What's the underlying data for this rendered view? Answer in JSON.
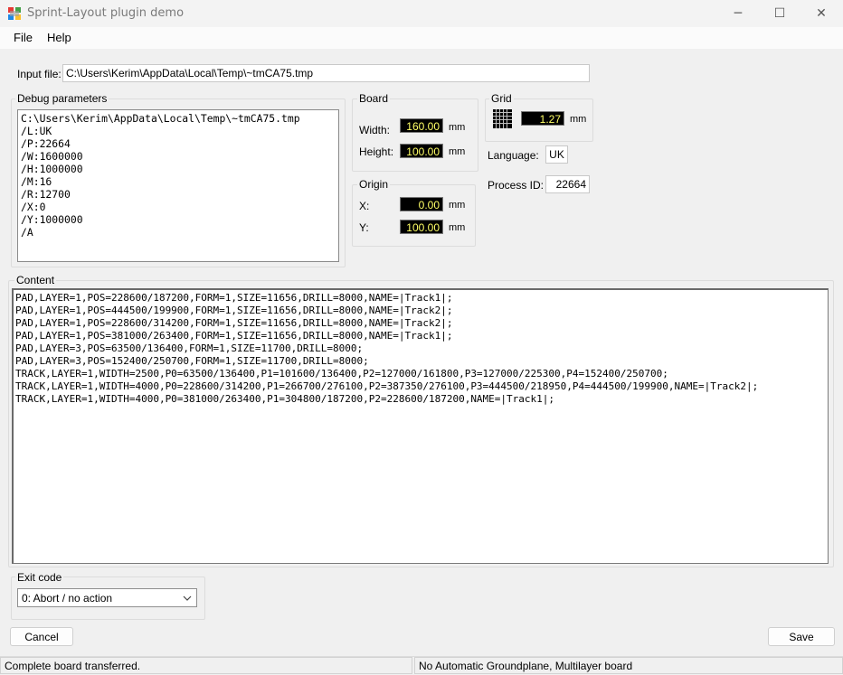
{
  "window": {
    "title": "Sprint-Layout plugin demo",
    "minimize_glyph": "─",
    "maximize_glyph": "☐",
    "close_glyph": "✕"
  },
  "menu": {
    "items": [
      "File",
      "Help"
    ]
  },
  "input_file": {
    "label": "Input file:",
    "value": "C:\\Users\\Kerim\\AppData\\Local\\Temp\\~tmCA75.tmp"
  },
  "debug": {
    "title": "Debug parameters",
    "text": "C:\\Users\\Kerim\\AppData\\Local\\Temp\\~tmCA75.tmp\n/L:UK\n/P:22664\n/W:1600000\n/H:1000000\n/M:16\n/R:12700\n/X:0\n/Y:1000000\n/A"
  },
  "board": {
    "title": "Board",
    "width_label": "Width:",
    "width_value": "160.00",
    "width_unit": "mm",
    "height_label": "Height:",
    "height_value": "100.00",
    "height_unit": "mm"
  },
  "origin": {
    "title": "Origin",
    "x_label": "X:",
    "x_value": "0.00",
    "x_unit": "mm",
    "y_label": "Y:",
    "y_value": "100.00",
    "y_unit": "mm"
  },
  "grid": {
    "title": "Grid",
    "value": "1.27",
    "unit": "mm",
    "icon": "grid-icon"
  },
  "language": {
    "label": "Language:",
    "value": "UK"
  },
  "process": {
    "label": "Process ID:",
    "value": "22664"
  },
  "content": {
    "title": "Content",
    "text": "PAD,LAYER=1,POS=228600/187200,FORM=1,SIZE=11656,DRILL=8000,NAME=|Track1|;\nPAD,LAYER=1,POS=444500/199900,FORM=1,SIZE=11656,DRILL=8000,NAME=|Track2|;\nPAD,LAYER=1,POS=228600/314200,FORM=1,SIZE=11656,DRILL=8000,NAME=|Track2|;\nPAD,LAYER=1,POS=381000/263400,FORM=1,SIZE=11656,DRILL=8000,NAME=|Track1|;\nPAD,LAYER=3,POS=63500/136400,FORM=1,SIZE=11700,DRILL=8000;\nPAD,LAYER=3,POS=152400/250700,FORM=1,SIZE=11700,DRILL=8000;\nTRACK,LAYER=1,WIDTH=2500,P0=63500/136400,P1=101600/136400,P2=127000/161800,P3=127000/225300,P4=152400/250700;\nTRACK,LAYER=1,WIDTH=4000,P0=228600/314200,P1=266700/276100,P2=387350/276100,P3=444500/218950,P4=444500/199900,NAME=|Track2|;\nTRACK,LAYER=1,WIDTH=4000,P0=381000/263400,P1=304800/187200,P2=228600/187200,NAME=|Track1|;"
  },
  "exit_code": {
    "title": "Exit code",
    "selected": "0: Abort / no action"
  },
  "buttons": {
    "cancel": "Cancel",
    "save": "Save"
  },
  "status": {
    "left": "Complete board transferred.",
    "right": "No Automatic Groundplane, Multilayer board"
  }
}
